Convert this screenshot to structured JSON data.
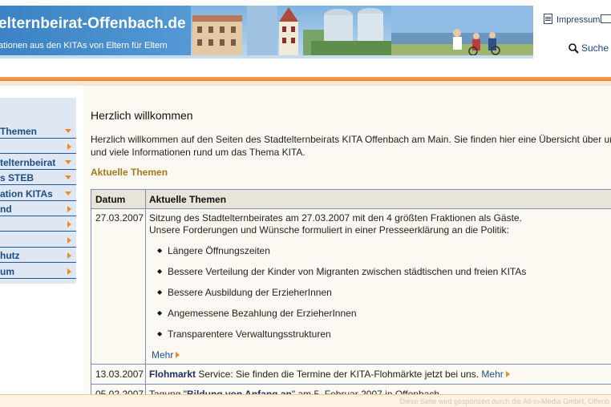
{
  "header": {
    "site_title": "elternbeirat-Offenbach.de",
    "site_subtitle": "ationen aus den KITAs von Eltern für Eltern",
    "impressum_label": "Impressum",
    "search_label": "Suche"
  },
  "colors": {
    "header_bar": "#e8822a",
    "nav_text": "#1a4e8a",
    "nav_arrow": "#ee8a2a",
    "section_title": "#a7791a",
    "link": "#1d4f9b"
  },
  "sidebar": {
    "items": [
      {
        "label": "Themen",
        "arrow": "down"
      },
      {
        "label": "",
        "arrow": "right"
      },
      {
        "label": "telternbeirat",
        "arrow": "down"
      },
      {
        "label": "s STEB",
        "arrow": "down"
      },
      {
        "label": "ation KITAs",
        "arrow": "down"
      },
      {
        "label": "nd",
        "arrow": "right"
      },
      {
        "label": "",
        "arrow": "right"
      },
      {
        "label": "",
        "arrow": "right"
      },
      {
        "label": "hutz",
        "arrow": "right"
      },
      {
        "label": "um",
        "arrow": "right"
      }
    ]
  },
  "main": {
    "title": "Herzlich willkommen",
    "intro_line1": "Herzlich willkommen auf den Seiten des Stadtelternbeirats KITA Offenbach am Main. Sie finden hier eine Übersicht über unsere",
    "intro_line2": "und viele Informationen rund um das Thema KITA.",
    "section_title": "Aktuelle Themen",
    "table": {
      "col_date": "Datum",
      "col_topics": "Aktuelle Themen",
      "rows": [
        {
          "date": "27.03.2007",
          "line1": "Sitzung des Stadtelternbeirates am 27.03.2007 mit den 4 größten Fraktionen als Gäste.",
          "line2": "Unsere Forderungen und Wünsche formuliert in einer Presseerklärung an die Politik:",
          "bullets": [
            "Längere Öffnungszeiten",
            "Bessere Verteilung der Kinder von Migranten zwischen städtischen und freien KITAs",
            "Bessere Ausbildung der ErzieherInnen",
            "Angemessene Bezahlung der ErzieherInnen",
            "Transparentere Verwaltungsstrukturen"
          ],
          "more": "Mehr"
        },
        {
          "date": "13.03.2007",
          "bold": "Flohmarkt",
          "text": " Service: Sie finden die Termine der KITA-Flohmärkte jetzt bei uns. ",
          "more": "Mehr"
        },
        {
          "date": "05.02.2007",
          "text_pre": "Tagung \"",
          "bold": "Bildung von Anfang an",
          "text_post": "\" am 5. Februar 2007 in Offenbach"
        }
      ]
    }
  },
  "footer": {
    "text": "Diese Seite wird gesponsert durch die All-in-Media GmbH, Offenb"
  }
}
